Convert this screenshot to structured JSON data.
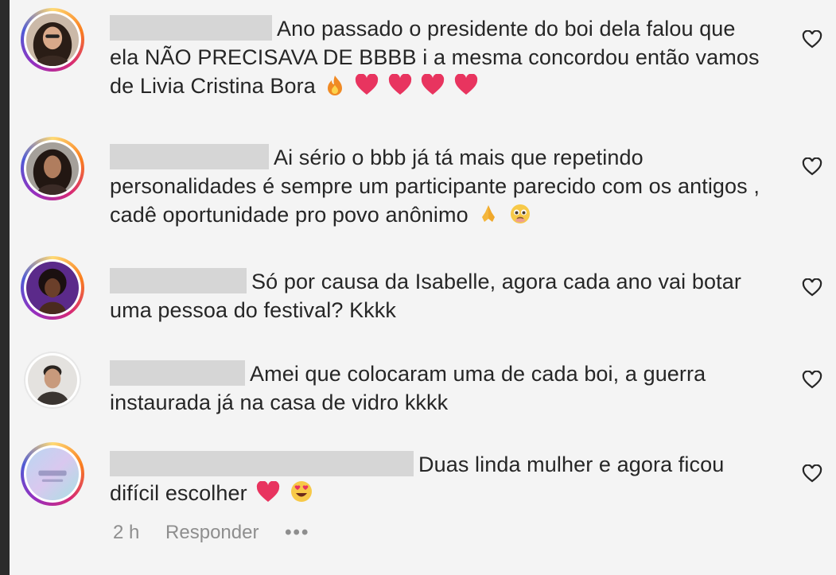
{
  "comments": [
    {
      "text": "Ano passado o presidente do boi dela falou que ela NÃO PRECISAVA DE BBBB i a mesma concordou então vamos de Livia Cristina Bora",
      "emojis": [
        "fire",
        "heart",
        "heart",
        "heart",
        "heart"
      ]
    },
    {
      "text": "Ai sério o bbb já tá mais que repetindo personalidades é sempre um participante parecido com os antigos , cadê oportunidade pro povo anônimo",
      "emojis": [
        "praying-hands",
        "pleading-face"
      ]
    },
    {
      "text": "Só por causa da Isabelle, agora cada ano vai botar uma pessoa do festival? Kkkk",
      "emojis": []
    },
    {
      "text": "Amei que colocaram uma de cada boi, a guerra instaurada já na casa de vidro kkkk",
      "emojis": []
    },
    {
      "text": "Duas linda mulher e agora ficou difícil escolher",
      "emojis": [
        "heart",
        "heart-eyes"
      ]
    }
  ],
  "footer": {
    "time": "2 h",
    "reply_label": "Responder",
    "more_label": "•••"
  },
  "colors": {
    "heart_emoji": "#e8345f",
    "text": "#262626",
    "meta": "#8e8e8e",
    "redacted": "#d6d6d6"
  }
}
